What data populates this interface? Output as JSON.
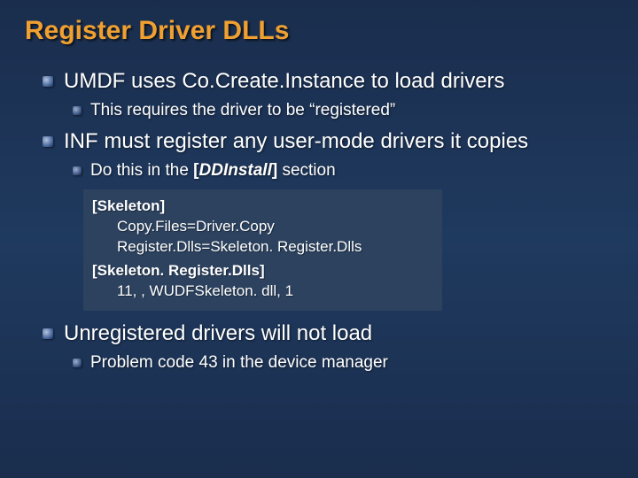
{
  "title": "Register Driver DLLs",
  "bullets": {
    "b1": "UMDF uses Co.Create.Instance to load drivers",
    "b1a": "This requires the driver to be “registered”",
    "b2": "INF must register any user-mode drivers it copies",
    "b2a_pre": "Do this in the ",
    "b2a_bold": "[",
    "b2a_ital": "DDInstall",
    "b2a_bold2": "]",
    "b2a_post": " section",
    "b3": "Unregistered drivers will not load",
    "b3a": "Problem code 43 in the device manager"
  },
  "code": {
    "s1": "[Skeleton]",
    "l1": "Copy.Files=Driver.Copy",
    "l2": "Register.Dlls=Skeleton. Register.Dlls",
    "s2": "[Skeleton. Register.Dlls]",
    "l3": "11, , WUDFSkeleton. dll, 1"
  }
}
